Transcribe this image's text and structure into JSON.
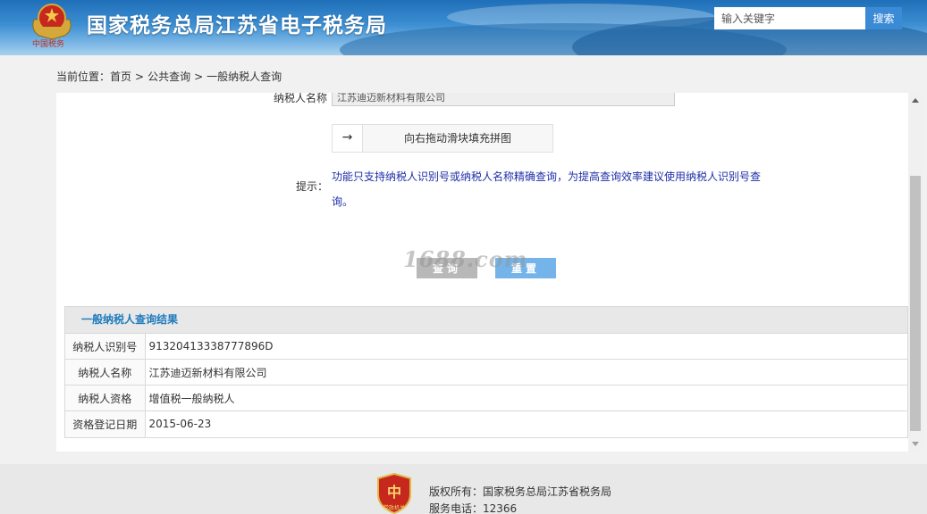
{
  "header": {
    "emblem_caption": "中国税务",
    "title": "国家税务总局江苏省电子税务局",
    "search_placeholder": "输入关键字",
    "search_button": "搜索"
  },
  "breadcrumb": {
    "prefix": "当前位置：",
    "items": [
      "首页",
      "公共查询",
      "一般纳税人查询"
    ],
    "separator": ">"
  },
  "form": {
    "name_label": "纳税人名称",
    "name_value": "江苏迪迈新材料有限公司",
    "slider_text": "向右拖动滑块填充拼图",
    "slider_arrow": "→",
    "tip_label": "提示：",
    "tip_text": "功能只支持纳税人识别号或纳税人名称精确查询，为提高查询效率建议使用纳税人识别号查询。",
    "query_button": "查询",
    "reset_button": "重置",
    "watermark": "1688.com"
  },
  "results": {
    "title": "一般纳税人查询结果",
    "rows": [
      {
        "key": "纳税人识别号",
        "value": "91320413338777896D"
      },
      {
        "key": "纳税人名称",
        "value": "江苏迪迈新材料有限公司"
      },
      {
        "key": "纳税人资格",
        "value": "增值税一般纳税人"
      },
      {
        "key": "资格登记日期",
        "value": "2015-06-23"
      }
    ]
  },
  "footer": {
    "badge_caption": "党政机关",
    "copyright": "版权所有：国家税务总局江苏省税务局",
    "hotline": "服务电话：12366"
  },
  "colors": {
    "header_blue": "#3d8fd3",
    "link_blue": "#1f7bbd",
    "tip_blue": "#1e2fa8",
    "reset_button": "#74b4ea",
    "query_button": "#b8b8b8"
  }
}
